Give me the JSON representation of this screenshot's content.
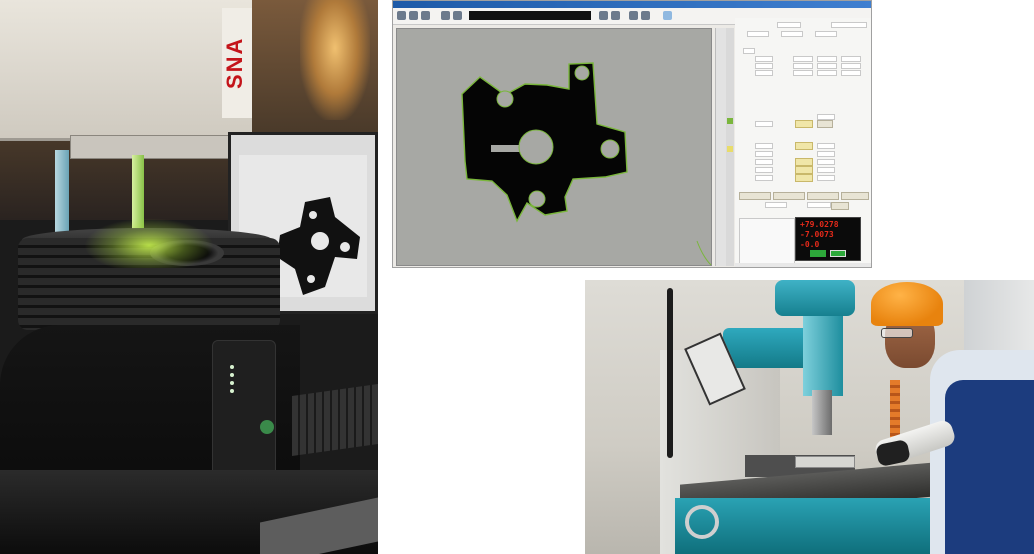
{
  "left_photo": {
    "brand_text": "SNA",
    "part_on_screen": "machined-part"
  },
  "software": {
    "title": "",
    "colors": {
      "titlebar": "#1d5aa8",
      "viewport": "#a7a8a4",
      "part": "#000000",
      "edge_highlight": "#7ab63c",
      "dro_text": "#e42a1a"
    },
    "dro": {
      "lines": [
        "+79.0278",
        "-7.0073",
        "-0.0"
      ]
    }
  },
  "bottom_photo": {
    "subject": "milling-machine-operator",
    "colors": {
      "machine": "#1e8e9e",
      "hardhat": "#e8830e",
      "overall": "#1c3c7e"
    }
  }
}
